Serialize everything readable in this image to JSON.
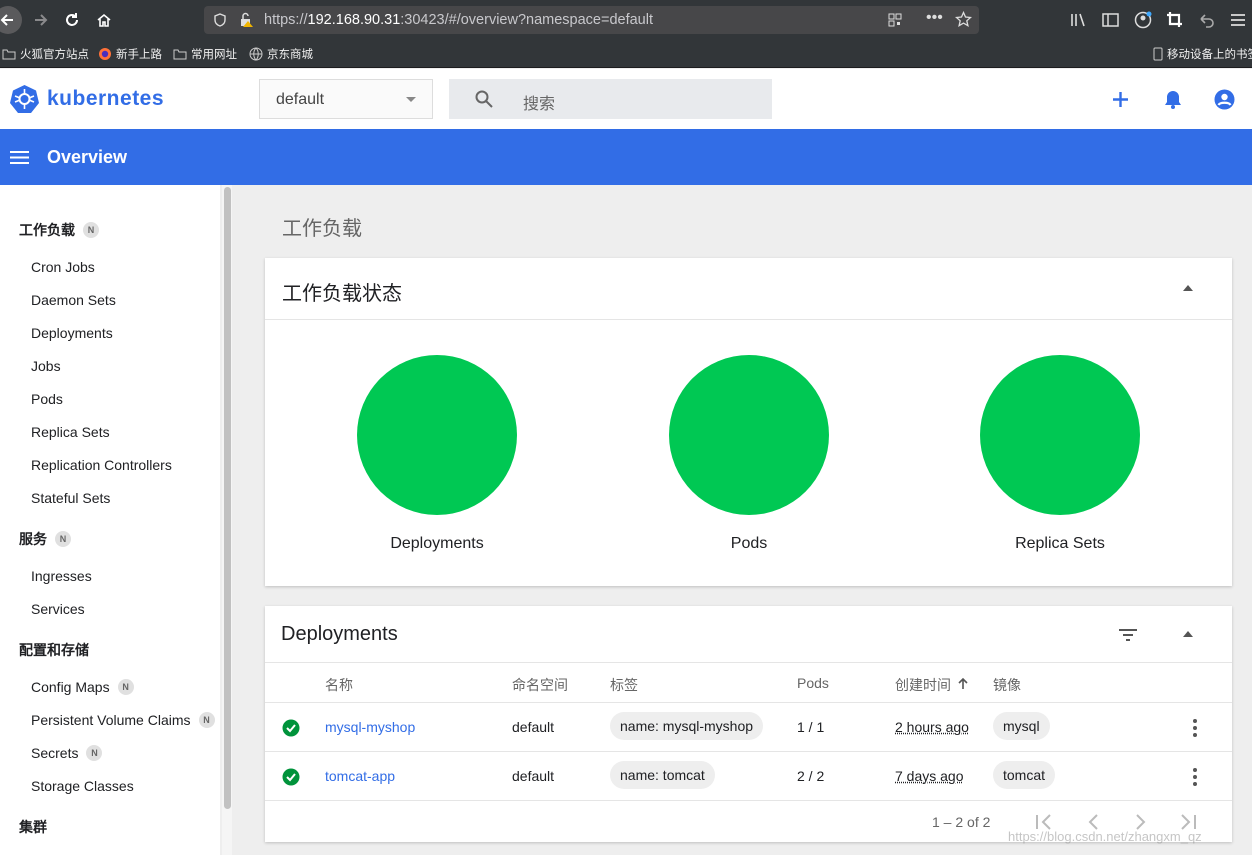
{
  "browser": {
    "url_prefix": "https://",
    "url_host": "192.168.90.31",
    "url_rest": ":30423/#/overview?namespace=default",
    "bookmarks": [
      "火狐官方站点",
      "新手上路",
      "常用网址",
      "京东商城"
    ],
    "mobile_bookmarks": "移动设备上的书签"
  },
  "app": {
    "logo_text": "kubernetes",
    "namespace": "default",
    "search_placeholder": "搜索",
    "page_title": "Overview"
  },
  "sidebar": {
    "sections": [
      {
        "label": "工作负载",
        "badge": "N",
        "items": [
          {
            "label": "Cron Jobs"
          },
          {
            "label": "Daemon Sets"
          },
          {
            "label": "Deployments"
          },
          {
            "label": "Jobs"
          },
          {
            "label": "Pods"
          },
          {
            "label": "Replica Sets"
          },
          {
            "label": "Replication Controllers"
          },
          {
            "label": "Stateful Sets"
          }
        ]
      },
      {
        "label": "服务",
        "badge": "N",
        "items": [
          {
            "label": "Ingresses"
          },
          {
            "label": "Services"
          }
        ]
      },
      {
        "label": "配置和存储",
        "items": [
          {
            "label": "Config Maps",
            "badge": "N"
          },
          {
            "label": "Persistent Volume Claims",
            "badge": "N"
          },
          {
            "label": "Secrets",
            "badge": "N"
          },
          {
            "label": "Storage Classes"
          }
        ]
      },
      {
        "label": "集群"
      }
    ]
  },
  "main": {
    "section_title": "工作负载",
    "status_card": {
      "title": "工作负载状态",
      "charts": [
        {
          "label": "Deployments",
          "color": "#00c853"
        },
        {
          "label": "Pods",
          "color": "#00c853"
        },
        {
          "label": "Replica Sets",
          "color": "#00c853"
        }
      ]
    },
    "deployments_card": {
      "title": "Deployments",
      "columns": [
        "名称",
        "命名空间",
        "标签",
        "Pods",
        "创建时间",
        "镜像"
      ],
      "rows": [
        {
          "name": "mysql-myshop",
          "namespace": "default",
          "label": "name: mysql-myshop",
          "pods": "1 / 1",
          "created": "2 hours ago",
          "image": "mysql"
        },
        {
          "name": "tomcat-app",
          "namespace": "default",
          "label": "name: tomcat",
          "pods": "2 / 2",
          "created": "7 days ago",
          "image": "tomcat"
        }
      ],
      "pagination": "1 – 2 of 2"
    }
  },
  "watermark": "https://blog.csdn.net/zhangxm_qz",
  "colors": {
    "accent": "#326de6",
    "ok": "#00c853",
    "link": "#326de6"
  }
}
